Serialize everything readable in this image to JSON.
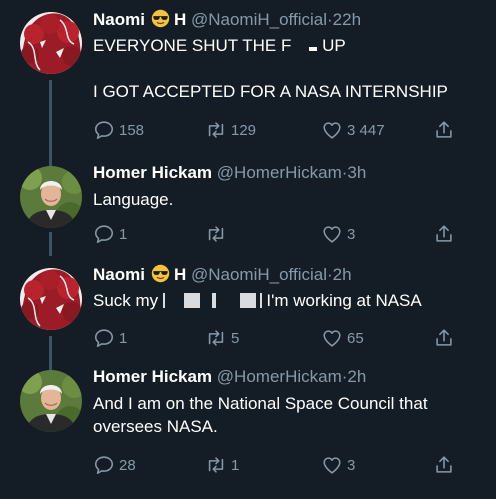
{
  "tweets": [
    {
      "name": "Naomi",
      "name_suffix": "H",
      "handle": "@NaomiH_official",
      "time": "22h",
      "line1_prefix": "EVERYONE SHUT THE F",
      "line1_suffix": "UP",
      "line2": "I GOT ACCEPTED FOR A NASA INTERNSHIP",
      "reply_count": "158",
      "retweet_count": "129",
      "like_count": "3 447"
    },
    {
      "name": "Homer Hickam",
      "handle": "@HomerHickam",
      "time": "3h",
      "text": "Language.",
      "reply_count": "1",
      "retweet_count": "",
      "like_count": "3"
    },
    {
      "name": "Naomi",
      "name_suffix": "H",
      "handle": "@NaomiH_official",
      "time": "2h",
      "text_prefix": "Suck my",
      "text_suffix": "I'm working at NASA",
      "reply_count": "1",
      "retweet_count": "5",
      "like_count": "65"
    },
    {
      "name": "Homer Hickam",
      "handle": "@HomerHickam",
      "time": "2h",
      "text": "And I am on the National Space Council that oversees NASA.",
      "reply_count": "28",
      "retweet_count": "1",
      "like_count": "3"
    }
  ],
  "separator": "·",
  "icons": [
    "reply-icon",
    "retweet-icon",
    "like-icon",
    "share-icon",
    "sunglasses-emoji-icon"
  ],
  "colors": {
    "background": "#141d26",
    "secondary_text": "#8899a6",
    "thread_line": "#3d5466"
  }
}
